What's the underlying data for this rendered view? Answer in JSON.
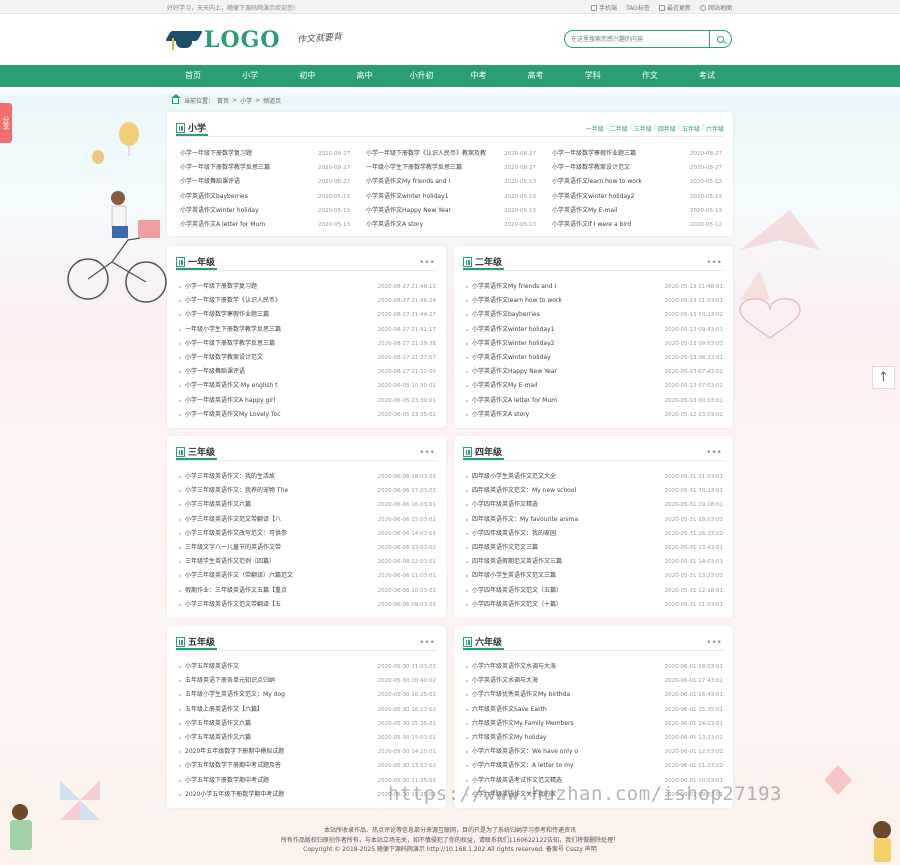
{
  "topbar": {
    "welcome": "好好学习，天天向上，随便下源码网演示欢迎您!",
    "links": [
      "手机端",
      "TAG标签",
      "最近更新",
      "网站地图"
    ]
  },
  "logo": {
    "text": "LOGO",
    "slogan": "作文就要背"
  },
  "search": {
    "placeholder": "在这里搜索您感兴趣的内容"
  },
  "nav": [
    "首页",
    "小学",
    "初中",
    "高中",
    "小升初",
    "中考",
    "高考",
    "学科",
    "作文",
    "考试"
  ],
  "breadcrumb": {
    "label": "当前位置：",
    "items": [
      "首页",
      "小学",
      "频道页"
    ],
    "sep": ">"
  },
  "share": "分享",
  "totop": "↑",
  "main": {
    "title": "小学",
    "grades": [
      "一年级",
      "二年级",
      "三年级",
      "四年级",
      "五年级",
      "六年级"
    ],
    "sep": "/",
    "columns": [
      [
        {
          "t": "小学一年级下册数学复习题",
          "d": "2020-08-27"
        },
        {
          "t": "小学一年级下册数学教学反思三篇",
          "d": "2020-08-27"
        },
        {
          "t": "小学一年级舞蹈课评语",
          "d": "2020-08-27"
        },
        {
          "t": "小学英语作文bayberries",
          "d": "2020-05-13"
        },
        {
          "t": "小学英语作文winter holiday",
          "d": "2020-05-13"
        },
        {
          "t": "小学英语作文A letter for Mum",
          "d": "2020-05-13"
        }
      ],
      [
        {
          "t": "小学一年级下册数学《认识人民币》教案及教",
          "d": "2020-08-27"
        },
        {
          "t": "一年级小学生下册数学教学反思三篇",
          "d": "2020-08-27"
        },
        {
          "t": "小学英语作文My friends and I",
          "d": "2020-05-13"
        },
        {
          "t": "小学英语作文winter holiday1",
          "d": "2020-05-13"
        },
        {
          "t": "小学英语作文Happy New Year",
          "d": "2020-05-13"
        },
        {
          "t": "小学英语作文A story",
          "d": "2020-05-13"
        }
      ],
      [
        {
          "t": "小学一年级数学寒假作业题三篇",
          "d": "2020-08-27"
        },
        {
          "t": "小学一年级数学教案设计范文",
          "d": "2020-08-27"
        },
        {
          "t": "小学英语作文learn how to work",
          "d": "2020-05-13"
        },
        {
          "t": "小学英语作文winter holiday2",
          "d": "2020-05-13"
        },
        {
          "t": "小学英语作文My E-mail",
          "d": "2020-05-13"
        },
        {
          "t": "小学英语作文If I were a bird",
          "d": "2020-05-12"
        }
      ]
    ]
  },
  "panels": [
    {
      "title": "一年级",
      "items": [
        {
          "t": "小学一年级下册数学复习题",
          "d": "2020-08-27 21:48:11"
        },
        {
          "t": "小学一年级下册数学《认识人民币》",
          "d": "2020-08-27 21:46:24"
        },
        {
          "t": "小学一年级数学寒假作业题三篇",
          "d": "2020-08-27 21:44:27"
        },
        {
          "t": "一年级小学生下册数学教学反思三篇",
          "d": "2020-08-27 21:41:17"
        },
        {
          "t": "小学一年级下册数学教学反思三篇",
          "d": "2020-08-27 21:39:38"
        },
        {
          "t": "小学一年级数学教案设计范文",
          "d": "2020-08-27 21:37:07"
        },
        {
          "t": "小学一年级舞蹈课评语",
          "d": "2020-08-27 21:32:00"
        },
        {
          "t": "小学一年级英语作文:My english t",
          "d": "2020-06-05 10:30:01"
        },
        {
          "t": "小学一年级英语作文A happy girl",
          "d": "2020-06-05 23:39:01"
        },
        {
          "t": "小学一年级英语作文My Lovely Toc",
          "d": "2020-06-05 23:35:02"
        }
      ]
    },
    {
      "title": "二年级",
      "items": [
        {
          "t": "小学英语作文My friends and I",
          "d": "2020-05-13 11:48:01"
        },
        {
          "t": "小学英语作文learn how to work",
          "d": "2020-05-13 11:03:01"
        },
        {
          "t": "小学英语作文bayberries",
          "d": "2020-05-13 10:23:02"
        },
        {
          "t": "小学英语作文winter holiday1",
          "d": "2020-05-13 09:43:01"
        },
        {
          "t": "小学英语作文winter holiday2",
          "d": "2020-05-13 09:03:01"
        },
        {
          "t": "小学英语作文winter holiday",
          "d": "2020-05-13 08:23:01"
        },
        {
          "t": "小学英语作文Happy New Year",
          "d": "2020-05-13 07:43:02"
        },
        {
          "t": "小学英语作文My E-mail",
          "d": "2020-05-13 07:03:02"
        },
        {
          "t": "小学英语作文A letter for Mum",
          "d": "2020-05-13 00:03:01"
        },
        {
          "t": "小学英语作文A story",
          "d": "2020-05-12 23:03:02"
        }
      ]
    },
    {
      "title": "三年级",
      "items": [
        {
          "t": "小学三年级英语作文：我的生活故",
          "d": "2020-06-06 18:03:01"
        },
        {
          "t": "小学三年级英语作文：我养的宠物 The",
          "d": "2020-06-06 17:03:01"
        },
        {
          "t": "小学三年级英语作文六篇",
          "d": "2020-06-06 16:03:01"
        },
        {
          "t": "小学三年级英语作文范文带翻译【八",
          "d": "2020-06-06 15:03:02"
        },
        {
          "t": "小学三年级英语作文改写范文：可供参",
          "d": "2020-06-06 14:03:01"
        },
        {
          "t": "三年级文字八一儿童节的英语作文带",
          "d": "2020-06-06 13:03:02"
        },
        {
          "t": "三年级学生英语作文范例（四篇）",
          "d": "2020-06-06 12:03:01"
        },
        {
          "t": "小学三年级英语作文（带翻译）六篇范文",
          "d": "2020-06-06 11:03:01"
        },
        {
          "t": "假期作业：三年级英语作文五篇【重点",
          "d": "2020-06-06 10:03:01"
        },
        {
          "t": "小学三年级英语作文范文带翻译【五",
          "d": "2020-06-06 09:03:01"
        }
      ]
    },
    {
      "title": "四年级",
      "items": [
        {
          "t": "四年级小学生英语作文范文大全",
          "d": "2020-05-31 21:03:01"
        },
        {
          "t": "四年级英语作文范文：My new school",
          "d": "2020-05-31 20:23:01"
        },
        {
          "t": "小学四年级英语作文精选",
          "d": "2020-05-31 19:18:01"
        },
        {
          "t": "四年级英语作文：My favourite anima",
          "d": "2020-05-31 18:03:01"
        },
        {
          "t": "小学四年级英语作文：我的家园",
          "d": "2020-05-31 16:33:02"
        },
        {
          "t": "四年级英语作文范文三篇",
          "d": "2020-05-31 13:43:01"
        },
        {
          "t": "四年级英语假期范文英语作文三篇",
          "d": "2020-05-31 14:03:01"
        },
        {
          "t": "四年级小学生英语作文范文三篇",
          "d": "2020-05-31 13:23:01"
        },
        {
          "t": "小学四年级英语作文范文（五篇）",
          "d": "2020-05-31 12:18:01"
        },
        {
          "t": "小学四年级英语作文范文（十篇）",
          "d": "2020-05-31 11:03:01"
        }
      ]
    },
    {
      "title": "五年级",
      "items": [
        {
          "t": "小学五年级英语作文",
          "d": "2020-05-30 21:03:01"
        },
        {
          "t": "五年级英语下册各单元知识点归纳",
          "d": "2020-05-30 20:40:02"
        },
        {
          "t": "五年级小学生英语作文范文：My dog",
          "d": "2020-05-30 16:25:01"
        },
        {
          "t": "五年级上册英语作文【六篇】",
          "d": "2020-05-30 16:13:02"
        },
        {
          "t": "小学五年级英语作文六篇",
          "d": "2020-05-30 15:35:01"
        },
        {
          "t": "小学五年级英语作文六篇",
          "d": "2020-05-30 15:03:01"
        },
        {
          "t": "2020年五年级数学下册期中模拟试题",
          "d": "2020-05-30 14:25:01"
        },
        {
          "t": "小学五年级数学下册期中考试题及答",
          "d": "2020-05-30 13:53:02"
        },
        {
          "t": "小学五年级下册数学期中考试题",
          "d": "2020-05-30 11:35:01"
        },
        {
          "t": "2020小学五年级下册数学期中考试题",
          "d": "2020-05-30 10:25:01"
        }
      ]
    },
    {
      "title": "六年级",
      "items": [
        {
          "t": "小学六年级英语作文水调与大海",
          "d": "2020-06-01 18:03:01"
        },
        {
          "t": "小学英语作文水调与大海",
          "d": "2020-06-01 17:43:02"
        },
        {
          "t": "小学六年级优秀英语作文My birthda",
          "d": "2020-06-01 16:43:01"
        },
        {
          "t": "六年级英语作文Save Earth",
          "d": "2020-06-01 15:35:01"
        },
        {
          "t": "六年级英语作文My Family Members",
          "d": "2020-06-01 14:03:01"
        },
        {
          "t": "六年级英语作文My holiday",
          "d": "2020-06-01 13:23:02"
        },
        {
          "t": "小学六年级英语作文：We have only o",
          "d": "2020-06-01 12:03:02"
        },
        {
          "t": "小学六年级英语作文：A letter to my",
          "d": "2020-06-01 11:23:02"
        },
        {
          "t": "小学六年级英语考试作文范文精选",
          "d": "2020-06-01 10:03:01"
        },
        {
          "t": "小学六年级英语作文关于我的家",
          "d": "2020-06-01 09:03:01"
        }
      ]
    }
  ],
  "footer": [
    "本站所收录作品、热点评论等信息部分来源互联网，目的只是为了系统归纳学习参考和传递资讯",
    "所有作品版权归原创作者所有，与本站立场无关，如不慎侵犯了你的权益，请联系我们1160622122告知，我们将做删除处理！",
    "Copyright © 2018-2025 随便下源码网演示 http://10.168.1.202 All rights reserved. 备案号 Csszy 声明"
  ],
  "watermark": "https://www.huzhan.com/ishop27193",
  "colors": {
    "accent": "#2aa072",
    "share": "#f26d6d"
  }
}
